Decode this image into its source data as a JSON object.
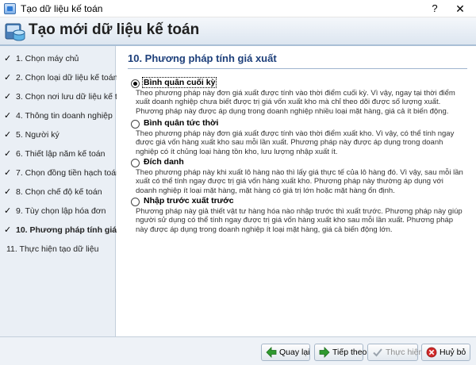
{
  "window": {
    "title": "Tạo dữ liệu kế toán",
    "help": "?",
    "close": "✕"
  },
  "header": {
    "title": "Tạo mới dữ liệu kế toán",
    "icon": "database-wizard-icon"
  },
  "sidebar": {
    "steps": [
      {
        "label": "1. Chọn máy chủ",
        "done": true
      },
      {
        "label": "2. Chọn loại dữ liệu kế toán",
        "done": true
      },
      {
        "label": "3. Chọn nơi lưu dữ liệu kế toán",
        "done": true
      },
      {
        "label": "4. Thông tin doanh nghiệp",
        "done": true
      },
      {
        "label": "5. Người ký",
        "done": true
      },
      {
        "label": "6. Thiết lập năm kế toán",
        "done": true
      },
      {
        "label": "7. Chọn đồng tiền hạch toán",
        "done": true
      },
      {
        "label": "8. Chọn chế độ kế toán",
        "done": true
      },
      {
        "label": "9. Tùy chọn lập hóa đơn",
        "done": true
      },
      {
        "label": "10. Phương pháp tính giá xuất",
        "done": true,
        "current": true
      },
      {
        "label": "11. Thực hiện tạo dữ liệu",
        "done": false
      }
    ],
    "check_glyph": "✓"
  },
  "main": {
    "title": "10. Phương pháp tính giá xuất",
    "selected": 0,
    "options": [
      {
        "label": "Bình quân cuối kỳ",
        "description": "Theo phương pháp này đơn giá xuất được tính vào thời điểm cuối kỳ. Vì vậy, ngay tại thời điểm xuất doanh nghiệp chưa biết được trị giá vốn xuất kho mà chỉ theo dõi được số lượng xuất. Phương pháp này được áp dụng trong doanh nghiệp nhiều loại mặt hàng, giá cả ít biến động."
      },
      {
        "label": "Bình quân tức thời",
        "description": "Theo phương pháp này đơn giá xuất được tính vào thời điểm xuất kho. Vì vậy, có thể tính ngay được giá vốn hàng xuất kho sau mỗi lần xuất. Phương pháp này được áp dụng trong doanh nghiệp có ít chủng loại hàng tồn kho, lưu lượng nhập xuất ít."
      },
      {
        "label": "Đích danh",
        "description": "Theo phương pháp này khi xuất lô hàng nào thì lấy giá thực tế của lô hàng đó. Vì vậy, sau mỗi lần xuất có thể tính ngay được trị giá vốn hàng xuất kho. Phương pháp này thường áp dụng với doanh nghiệp ít loại mặt hàng, mặt hàng có giá trị lớn hoặc mặt hàng ổn định."
      },
      {
        "label": "Nhập trước xuất trước",
        "description": "Phương pháp này giả thiết vật tư hàng hóa nào nhập trước thì xuất trước. Phương pháp này giúp người sử dụng có thể tính ngay được trị giá vốn hàng xuất kho sau mỗi lần xuất. Phương pháp này được áp dụng trong doanh nghiệp ít loại mặt hàng, giá cả biến động lớn."
      }
    ]
  },
  "footer": {
    "back": {
      "label": "Quay lại",
      "icon": "arrow-left-icon",
      "enabled": true
    },
    "next": {
      "label": "Tiếp theo",
      "icon": "arrow-right-icon",
      "enabled": true
    },
    "execute": {
      "label": "Thực hiện",
      "icon": "checkmark-icon",
      "enabled": false
    },
    "cancel": {
      "label": "Huỷ bỏ",
      "icon": "cancel-icon",
      "enabled": true
    }
  },
  "colors": {
    "accent_title": "#1d3f7a",
    "sidebar_bg": "#eaeff5",
    "arrow_green": "#2f9a2f",
    "cancel_red": "#d12a2a"
  }
}
